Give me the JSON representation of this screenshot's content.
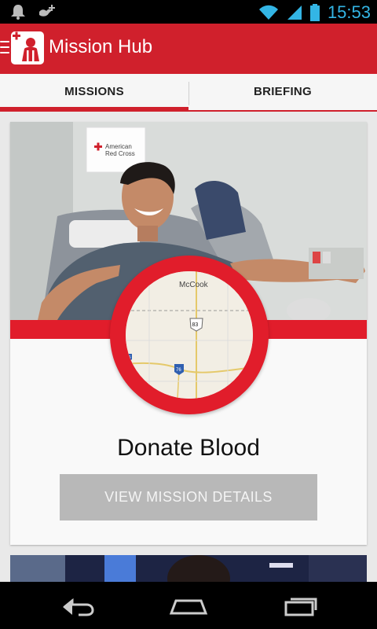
{
  "status_bar": {
    "time": "15:53",
    "left_icons": [
      "notification-bell-icon",
      "bird-plus-icon"
    ],
    "right_icons": [
      "wifi-icon",
      "signal-icon",
      "battery-icon"
    ]
  },
  "action_bar": {
    "title": "Mission Hub",
    "icon": "app-logo-icon",
    "accent_color": "#d0202c"
  },
  "tabs": [
    {
      "label": "MISSIONS",
      "selected": true
    },
    {
      "label": "BRIEFING",
      "selected": false
    }
  ],
  "photo": {
    "sign_text_line1": "American",
    "sign_text_line2": "Red Cross"
  },
  "map": {
    "place_label": "McCook",
    "highway_shield": "83",
    "interstate_shield_1": "76",
    "interstate_shield_2": "76"
  },
  "mission_card": {
    "title": "Donate Blood",
    "button_label": "VIEW MISSION DETAILS",
    "band_color": "#e11d2b"
  },
  "nav_bar": {
    "buttons": [
      "back-icon",
      "home-icon",
      "recent-apps-icon"
    ]
  }
}
